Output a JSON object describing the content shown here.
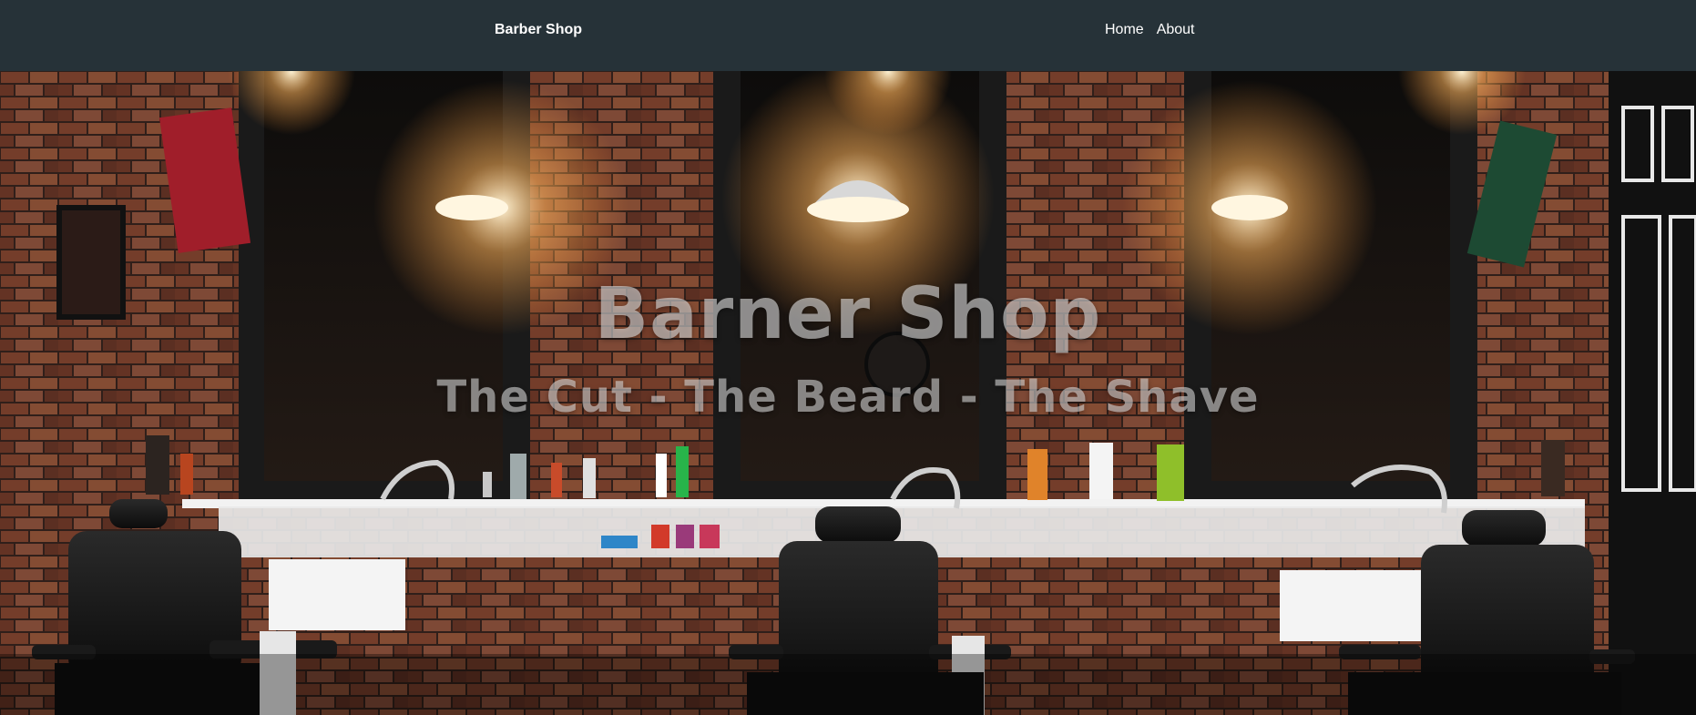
{
  "navbar": {
    "brand": "Barber Shop",
    "links": [
      {
        "label": "Home"
      },
      {
        "label": "About"
      }
    ]
  },
  "hero": {
    "title": "Barner Shop",
    "subtitle": "The Cut - The Beard - The Shave",
    "background_image": "barbershop-interior"
  },
  "colors": {
    "navbar_bg": "#263238",
    "nav_text": "#ffffff",
    "brick": "#8a4a33",
    "hero_text": "#dcdcdc"
  }
}
